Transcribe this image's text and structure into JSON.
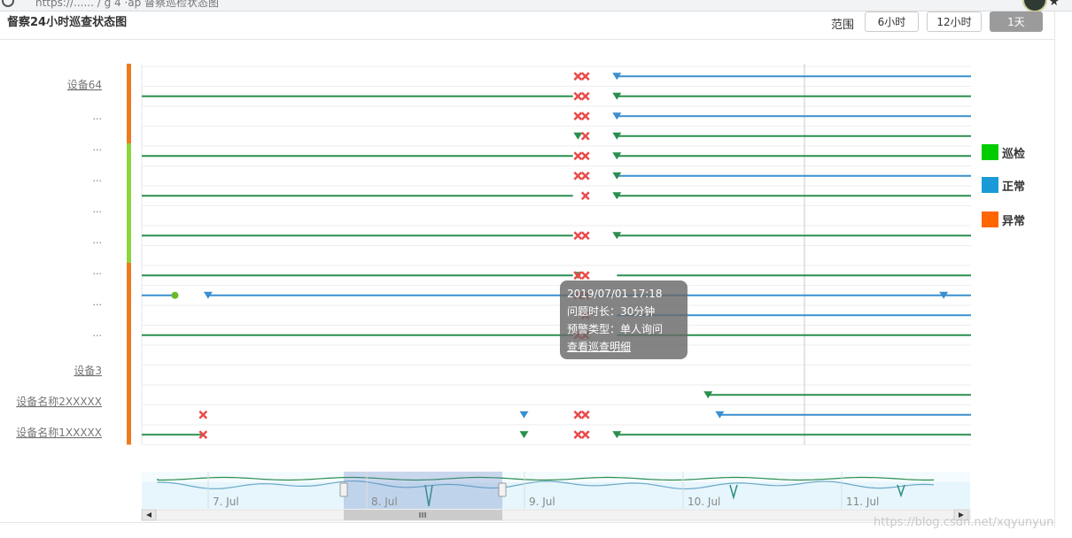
{
  "browser": {
    "url_fragment": "https://...... / g   4  ·ap   督察巡检状态图"
  },
  "header": {
    "title": "督察24小时巡查状态图",
    "range_label": "范围",
    "range_buttons": [
      {
        "label": "6小时",
        "active": false
      },
      {
        "label": "12小时",
        "active": false
      },
      {
        "label": "1天",
        "active": true
      }
    ]
  },
  "legend": [
    {
      "label": "巡检",
      "color": "#00cc00"
    },
    {
      "label": "正常",
      "color": "#1a9bd7"
    },
    {
      "label": "异常",
      "color": "#ff6600"
    }
  ],
  "tooltip": {
    "time": "2019/07/01 17:18",
    "duration": "问题时长：30分钟",
    "alert_type": "预警类型：单人询问",
    "link": "查看巡查明细"
  },
  "watermark": "https://blog.csdn.net/xqyunyun",
  "colors": {
    "patrol": "#2a8f4e",
    "normal": "#3a8fcf",
    "abnormal": "#ea4a4a",
    "group_orange": "#ee7a1e",
    "group_green": "#8cd63b"
  },
  "chart_data": {
    "type": "timeline",
    "x_range": [
      "6 Jul",
      "11 Jul"
    ],
    "navigator_ticks": [
      "7. Jul",
      "8. Jul",
      "9. Jul",
      "10. Jul",
      "11. Jul"
    ],
    "devices": [
      {
        "name": "设备64",
        "label_visible": true,
        "link": true
      },
      {
        "name": "...",
        "label_visible": true,
        "link": false
      },
      {
        "name": "...",
        "label_visible": true,
        "link": false
      },
      {
        "name": "...",
        "label_visible": true,
        "link": false
      },
      {
        "name": "...",
        "label_visible": true,
        "link": false
      },
      {
        "name": "...",
        "label_visible": true,
        "link": false
      },
      {
        "name": "...",
        "label_visible": true,
        "link": false
      },
      {
        "name": "...",
        "label_visible": true,
        "link": false
      },
      {
        "name": "...",
        "label_visible": true,
        "link": false
      },
      {
        "name": "设备3",
        "label_visible": true,
        "link": true
      },
      {
        "name": "设备名称2XXXXX",
        "label_visible": true,
        "link": true
      },
      {
        "name": "设备名称1XXXXX",
        "label_visible": true,
        "link": true
      }
    ],
    "rows": [
      {
        "segments": [
          {
            "status": "normal",
            "from": 0.573,
            "to": 1.0
          }
        ],
        "abnormal": [
          0.526,
          0.535
        ],
        "markers": [
          {
            "t": 0.573,
            "status": "normal"
          }
        ]
      },
      {
        "segments": [
          {
            "status": "patrol",
            "from": 0.0,
            "to": 0.52
          },
          {
            "status": "patrol",
            "from": 0.573,
            "to": 1.0
          }
        ],
        "abnormal": [
          0.526,
          0.535
        ],
        "markers": [
          {
            "t": 0.573,
            "status": "patrol"
          }
        ]
      },
      {
        "segments": [
          {
            "status": "normal",
            "from": 0.573,
            "to": 1.0
          }
        ],
        "abnormal": [
          0.526,
          0.535
        ],
        "markers": [
          {
            "t": 0.573,
            "status": "normal"
          }
        ]
      },
      {
        "segments": [
          {
            "status": "patrol",
            "from": 0.573,
            "to": 1.0
          }
        ],
        "abnormal": [
          0.535
        ],
        "markers": [
          {
            "t": 0.526,
            "status": "patrol"
          },
          {
            "t": 0.573,
            "status": "patrol"
          }
        ]
      },
      {
        "segments": [
          {
            "status": "patrol",
            "from": 0.0,
            "to": 0.52
          },
          {
            "status": "patrol",
            "from": 0.573,
            "to": 1.0
          }
        ],
        "abnormal": [
          0.526,
          0.535
        ],
        "markers": [
          {
            "t": 0.573,
            "status": "patrol"
          }
        ]
      },
      {
        "segments": [
          {
            "status": "normal",
            "from": 0.573,
            "to": 1.0
          }
        ],
        "abnormal": [
          0.526,
          0.535
        ],
        "markers": [
          {
            "t": 0.573,
            "status": "patrol"
          }
        ]
      },
      {
        "segments": [
          {
            "status": "patrol",
            "from": 0.0,
            "to": 0.52
          },
          {
            "status": "patrol",
            "from": 0.573,
            "to": 1.0
          }
        ],
        "abnormal": [
          0.535
        ],
        "markers": [
          {
            "t": 0.573,
            "status": "patrol"
          }
        ]
      },
      {
        "segments": [],
        "abnormal": [],
        "markers": []
      },
      {
        "segments": [
          {
            "status": "patrol",
            "from": 0.0,
            "to": 0.52
          },
          {
            "status": "patrol",
            "from": 0.573,
            "to": 1.0
          }
        ],
        "abnormal": [
          0.526,
          0.535
        ],
        "markers": [
          {
            "t": 0.573,
            "status": "patrol"
          }
        ]
      },
      {
        "segments": [],
        "abnormal": [],
        "markers": []
      },
      {
        "segments": [
          {
            "status": "patrol",
            "from": 0.0,
            "to": 0.52
          },
          {
            "status": "patrol",
            "from": 0.573,
            "to": 1.0
          }
        ],
        "abnormal": [
          0.526,
          0.535
        ],
        "markers": [
          {
            "t": 0.526,
            "status": "patrol"
          }
        ]
      },
      {
        "segments": [
          {
            "status": "normal",
            "from": 0.0,
            "to": 0.04
          },
          {
            "status": "normal",
            "from": 0.08,
            "to": 1.0
          }
        ],
        "abnormal": [
          0.526,
          0.535
        ],
        "markers": [
          {
            "t": 0.04,
            "status": "patrol-dot"
          },
          {
            "t": 0.08,
            "status": "normal"
          },
          {
            "t": 0.967,
            "status": "normal"
          }
        ]
      },
      {
        "segments": [
          {
            "status": "normal",
            "from": 0.573,
            "to": 1.0
          }
        ],
        "abnormal": [
          0.535
        ],
        "markers": []
      },
      {
        "segments": [
          {
            "status": "patrol",
            "from": 0.0,
            "to": 0.52
          },
          {
            "status": "patrol",
            "from": 0.573,
            "to": 1.0
          }
        ],
        "abnormal": [
          0.526,
          0.535
        ],
        "markers": []
      },
      {
        "segments": [],
        "abnormal": [],
        "markers": []
      },
      {
        "segments": [],
        "abnormal": [],
        "markers": []
      },
      {
        "segments": [
          {
            "status": "patrol",
            "from": 0.683,
            "to": 1.0
          }
        ],
        "abnormal": [],
        "markers": [
          {
            "t": 0.683,
            "status": "patrol"
          }
        ]
      },
      {
        "segments": [
          {
            "status": "normal",
            "from": 0.697,
            "to": 1.0
          }
        ],
        "abnormal": [
          0.074,
          0.526,
          0.535
        ],
        "markers": [
          {
            "t": 0.461,
            "status": "normal"
          },
          {
            "t": 0.697,
            "status": "normal"
          }
        ]
      },
      {
        "segments": [
          {
            "status": "patrol",
            "from": 0.0,
            "to": 0.074
          },
          {
            "status": "patrol",
            "from": 0.573,
            "to": 1.0
          }
        ],
        "abnormal": [
          0.074,
          0.526,
          0.535
        ],
        "markers": [
          {
            "t": 0.461,
            "status": "patrol"
          },
          {
            "t": 0.573,
            "status": "patrol"
          }
        ]
      }
    ],
    "group_bars": [
      {
        "from_row": 0,
        "to_row": 4,
        "color": "orange"
      },
      {
        "from_row": 4,
        "to_row": 10,
        "color": "green"
      },
      {
        "from_row": 10,
        "to_row": 19,
        "color": "orange"
      }
    ],
    "navigator_selection": [
      0.25,
      0.45
    ]
  }
}
